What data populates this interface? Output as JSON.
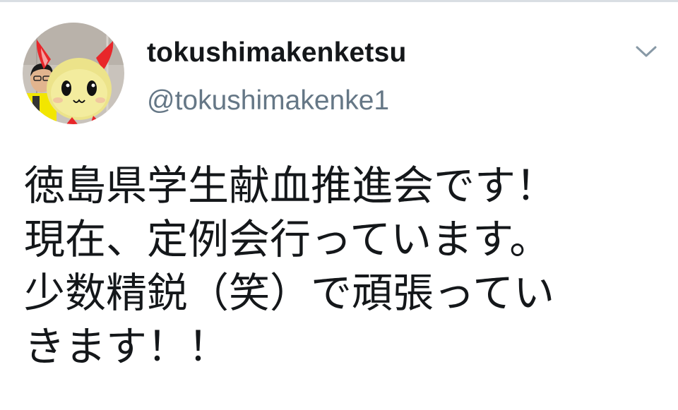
{
  "tweet": {
    "display_name": "tokushimakenketsu",
    "handle": "@tokushimakenke1",
    "text_lines": [
      "徳島県学生献血推進会です！",
      "現在、定例会行っています。",
      "少数精鋭（笑）で頑張ってい",
      "きます！！"
    ]
  },
  "icons": {
    "menu": "chevron-down-icon",
    "avatar": "avatar"
  },
  "colors": {
    "name": "#14171a",
    "handle": "#657786",
    "caret": "#8899a6",
    "mascot_red": "#e8262a",
    "mascot_yellow": "#ece38a"
  }
}
